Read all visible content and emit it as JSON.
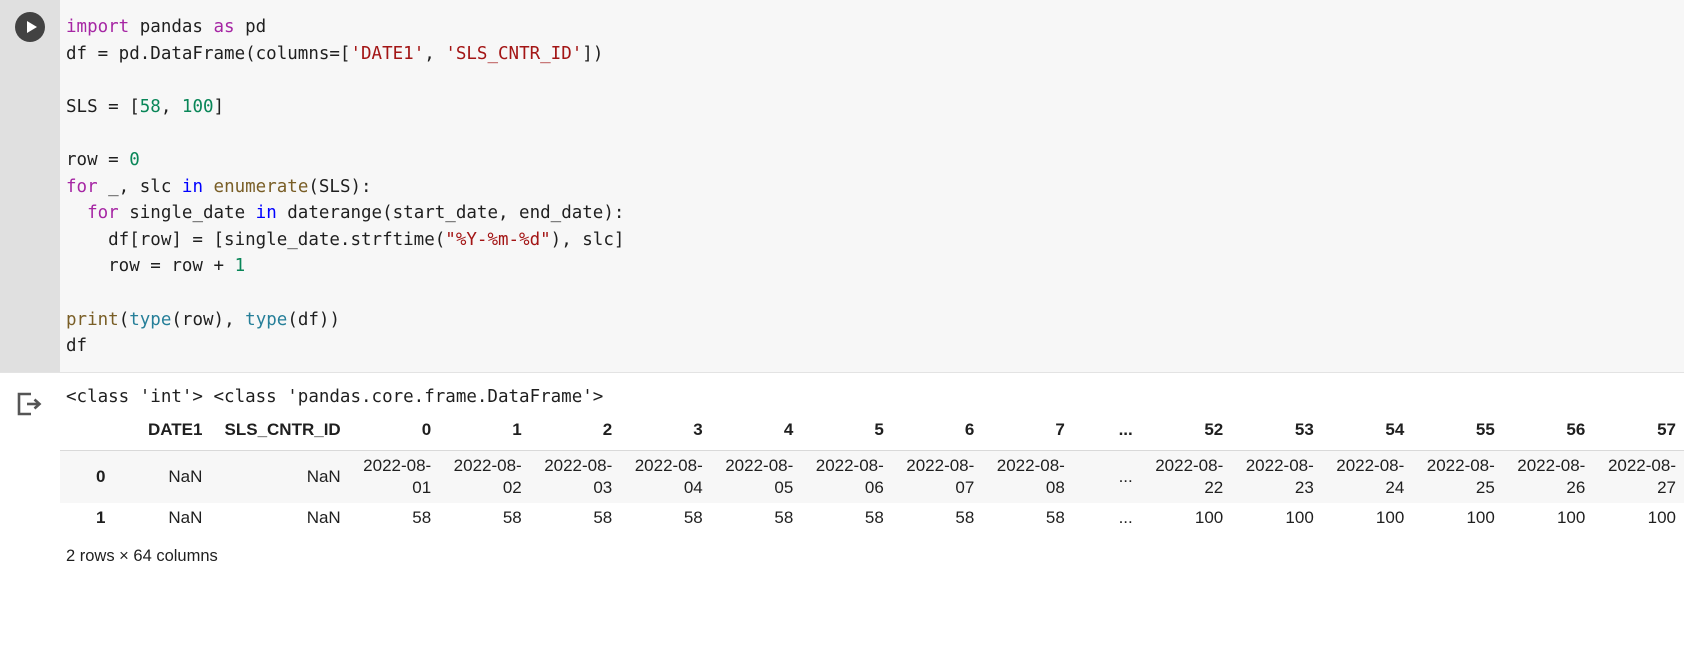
{
  "cell": {
    "run_button_label": "Run cell",
    "run_icon": "play-icon",
    "output_icon": "output-arrow-icon",
    "code_lines": [
      [
        {
          "t": "import",
          "c": "kw"
        },
        {
          "t": " pandas ",
          "c": "plain"
        },
        {
          "t": "as",
          "c": "kw"
        },
        {
          "t": " pd",
          "c": "plain"
        }
      ],
      [
        {
          "t": "df = pd.DataFrame(columns=[",
          "c": "plain"
        },
        {
          "t": "'DATE1'",
          "c": "str"
        },
        {
          "t": ", ",
          "c": "plain"
        },
        {
          "t": "'SLS_CNTR_ID'",
          "c": "str"
        },
        {
          "t": "])",
          "c": "plain"
        }
      ],
      [],
      [
        {
          "t": "SLS = [",
          "c": "plain"
        },
        {
          "t": "58",
          "c": "num"
        },
        {
          "t": ", ",
          "c": "plain"
        },
        {
          "t": "100",
          "c": "num"
        },
        {
          "t": "]",
          "c": "plain"
        }
      ],
      [],
      [
        {
          "t": "row = ",
          "c": "plain"
        },
        {
          "t": "0",
          "c": "num"
        }
      ],
      [
        {
          "t": "for",
          "c": "kw"
        },
        {
          "t": " _, slc ",
          "c": "plain"
        },
        {
          "t": "in",
          "c": "kw2"
        },
        {
          "t": " ",
          "c": "plain"
        },
        {
          "t": "enumerate",
          "c": "bi"
        },
        {
          "t": "(SLS):",
          "c": "plain"
        }
      ],
      [
        {
          "t": "  ",
          "c": "plain"
        },
        {
          "t": "for",
          "c": "kw"
        },
        {
          "t": " single_date ",
          "c": "plain"
        },
        {
          "t": "in",
          "c": "kw2"
        },
        {
          "t": " daterange(start_date, end_date):",
          "c": "plain"
        }
      ],
      [
        {
          "t": "    df[row] = [single_date.strftime(",
          "c": "plain"
        },
        {
          "t": "\"%Y-%m-%d\"",
          "c": "str"
        },
        {
          "t": "), slc]",
          "c": "plain"
        }
      ],
      [
        {
          "t": "    row = row + ",
          "c": "plain"
        },
        {
          "t": "1",
          "c": "num"
        }
      ],
      [],
      [
        {
          "t": "print",
          "c": "bi"
        },
        {
          "t": "(",
          "c": "plain"
        },
        {
          "t": "type",
          "c": "fn"
        },
        {
          "t": "(row), ",
          "c": "plain"
        },
        {
          "t": "type",
          "c": "fn"
        },
        {
          "t": "(df))",
          "c": "plain"
        }
      ],
      [
        {
          "t": "df",
          "c": "plain"
        }
      ]
    ],
    "code_plain": "import pandas as pd\ndf = pd.DataFrame(columns=['DATE1', 'SLS_CNTR_ID'])\n\nSLS = [58, 100]\n\nrow = 0\nfor _, slc in enumerate(SLS):\n  for single_date in daterange(start_date, end_date):\n    df[row] = [single_date.strftime(\"%Y-%m-%d\"), slc]\n    row = row + 1\n\nprint(type(row), type(df))\ndf"
  },
  "output": {
    "stdout": "<class 'int'> <class 'pandas.core.frame.DataFrame'>",
    "shape_note": "2 rows × 64 columns",
    "dataframe": {
      "index_header": "",
      "columns": [
        "DATE1",
        "SLS_CNTR_ID",
        "0",
        "1",
        "2",
        "3",
        "4",
        "5",
        "6",
        "7",
        "...",
        "52",
        "53",
        "54",
        "55",
        "56",
        "57"
      ],
      "rows": [
        {
          "index": "0",
          "values": [
            "NaN",
            "NaN",
            "2022-08-01",
            "2022-08-02",
            "2022-08-03",
            "2022-08-04",
            "2022-08-05",
            "2022-08-06",
            "2022-08-07",
            "2022-08-08",
            "...",
            "2022-08-22",
            "2022-08-23",
            "2022-08-24",
            "2022-08-25",
            "2022-08-26",
            "2022-08-27"
          ]
        },
        {
          "index": "1",
          "values": [
            "NaN",
            "NaN",
            "58",
            "58",
            "58",
            "58",
            "58",
            "58",
            "58",
            "58",
            "...",
            "100",
            "100",
            "100",
            "100",
            "100",
            "100"
          ]
        }
      ]
    }
  },
  "colors": {
    "code_bg": "#f7f7f7",
    "gutter_bg": "#e0e0e0",
    "run_button": "#424242",
    "keyword": "#a626a4",
    "keyword_in": "#0000ff",
    "string": "#a31515",
    "number": "#098658",
    "builtin": "#795e26",
    "function": "#267f99",
    "row_even_bg": "#f7f7f7",
    "text": "#1f1f1f"
  }
}
